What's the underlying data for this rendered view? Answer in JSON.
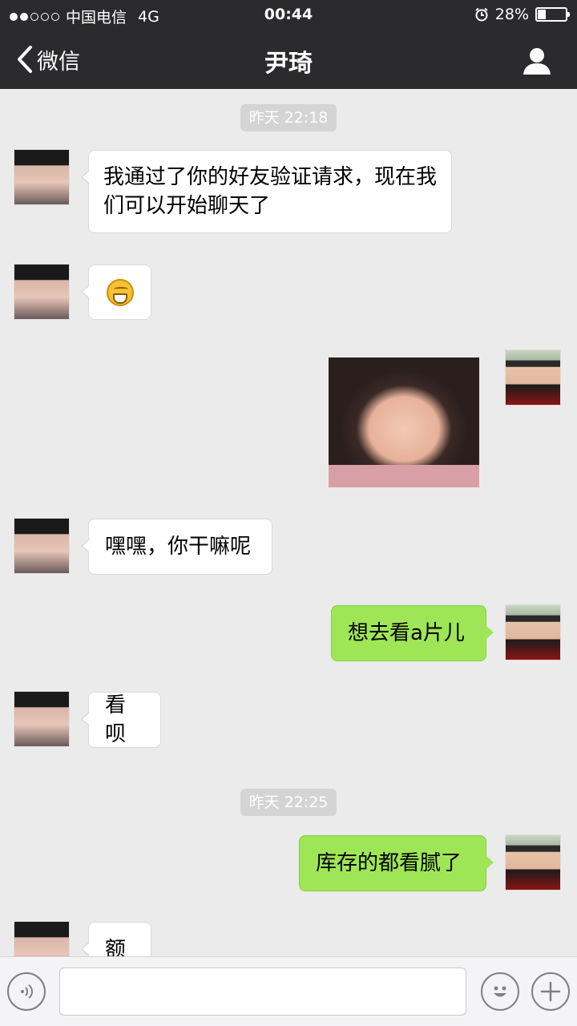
{
  "status_bar": {
    "carrier": "中国电信",
    "network": "4G",
    "time": "00:44",
    "battery_percent": "28%",
    "battery_level": 0.28,
    "signal_bars_filled": 2,
    "signal_bars_total": 5
  },
  "nav": {
    "back_label": "微信",
    "title": "尹琦",
    "back_icon": "chevron-left-icon",
    "profile_icon": "person-icon"
  },
  "messages": {
    "timestamp_1": "昨天 22:18",
    "msg_1": "我通过了你的好友验证请求，现在我们可以开始聊天了",
    "msg_3": "嘿嘿，你干嘛呢",
    "msg_4": "想去看a片儿",
    "msg_5": "看呗",
    "timestamp_2": "昨天 22:25",
    "msg_6": "库存的都看腻了",
    "msg_7": "额"
  },
  "input_bar": {
    "voice_icon": "voice-icon",
    "emoji_icon": "emoji-icon",
    "plus_icon": "plus-icon",
    "input_value": ""
  },
  "colors": {
    "header_bg": "#2b2b2d",
    "chat_bg": "#ebebeb",
    "sent_bubble": "#9fe657",
    "received_bubble": "#ffffff"
  }
}
